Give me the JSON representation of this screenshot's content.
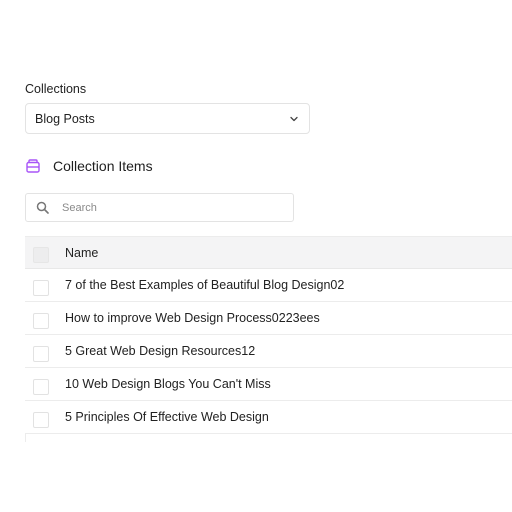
{
  "collections": {
    "label": "Collections",
    "selected": "Blog Posts"
  },
  "collection_items": {
    "title": "Collection Items",
    "search_placeholder": "Search"
  },
  "table": {
    "header_name": "Name",
    "rows": [
      "7 of the Best Examples of Beautiful Blog Design02",
      "How to improve Web Design Process0223ees",
      "5 Great Web Design Resources12",
      "10 Web Design Blogs You Can't Miss",
      "5 Principles Of Effective Web Design"
    ]
  },
  "colors": {
    "accent": "#a855f7"
  },
  "icons": {
    "collection": "database-icon",
    "search": "search-icon",
    "select": "chevron-down-icon"
  }
}
